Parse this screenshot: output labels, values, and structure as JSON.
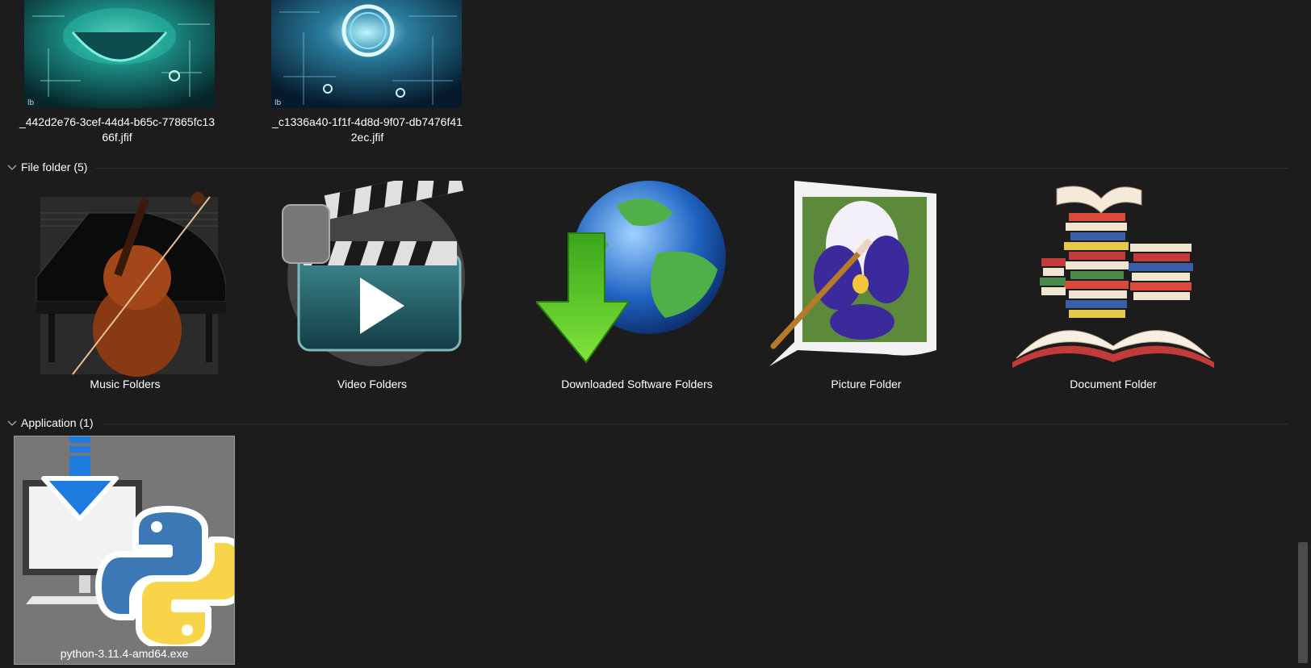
{
  "groups": {
    "file_folder": {
      "title": "File folder (5)"
    },
    "application": {
      "title": "Application (1)"
    }
  },
  "images": [
    {
      "name": "_442d2e76-3cef-44d4-b65c-77865fc1366f.jfif",
      "line1": "_442d2e76-3cef-44d4-b65c-77865fc13",
      "line2": "66f.jfif"
    },
    {
      "name": "_c1336a40-1f1f-4d8d-9f07-db7476f412ec.jfif",
      "line1": "_c1336a40-1f1f-4d8d-9f07-db7476f41",
      "line2": "2ec.jfif"
    }
  ],
  "folders": [
    {
      "name": "Music Folders",
      "icon": "music-instruments-icon"
    },
    {
      "name": "Video Folders",
      "icon": "clapperboard-icon"
    },
    {
      "name": "Downloaded Software Folders",
      "icon": "globe-download-icon"
    },
    {
      "name": "Picture Folder",
      "icon": "picture-frame-icon"
    },
    {
      "name": "Document Folder",
      "icon": "book-stack-icon"
    }
  ],
  "applications": [
    {
      "name": "python-3.11.4-amd64.exe",
      "icon": "python-installer-icon",
      "selected": true
    }
  ],
  "colors": {
    "background": "#1c1c1c",
    "selection": "#777777",
    "text": "#ffffff"
  }
}
